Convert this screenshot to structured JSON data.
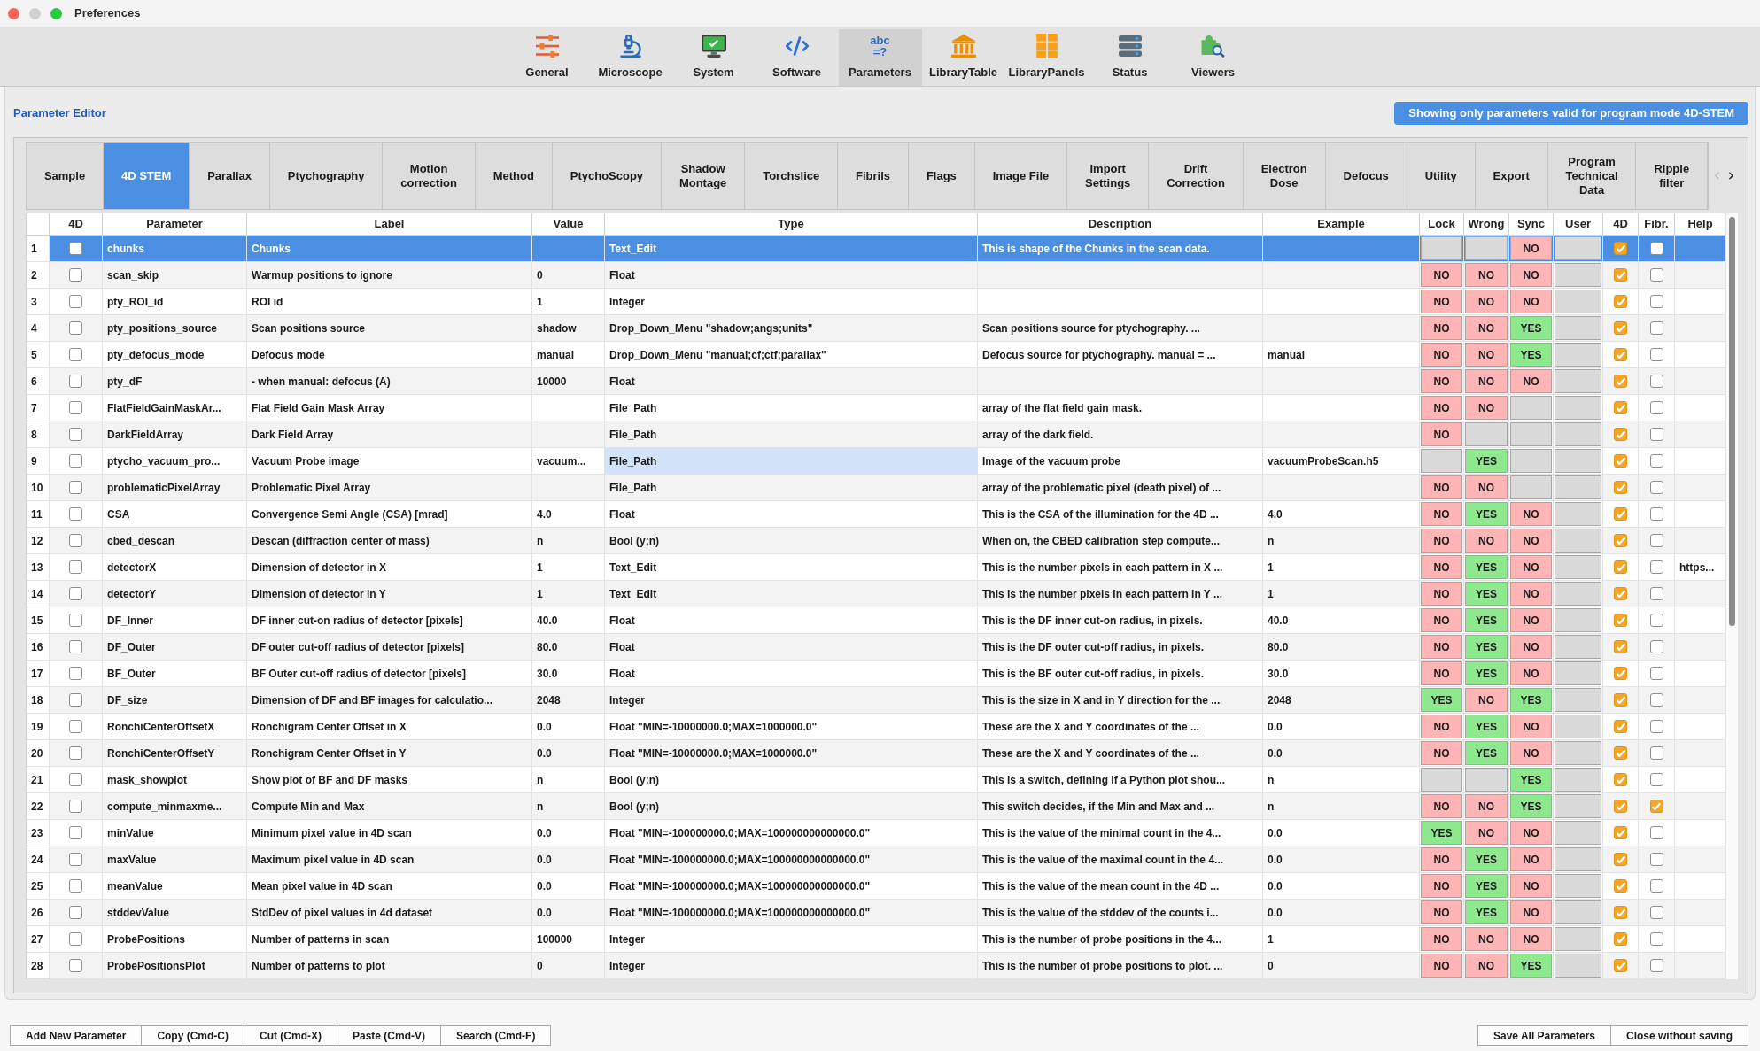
{
  "window": {
    "title": "Preferences",
    "controls": [
      {
        "kind": "close",
        "disabled": false
      },
      {
        "kind": "minimize",
        "disabled": true
      },
      {
        "kind": "zoom",
        "disabled": false
      }
    ]
  },
  "toolbar": {
    "items": [
      {
        "label": "General",
        "selected": false
      },
      {
        "label": "Microscope",
        "selected": false
      },
      {
        "label": "System",
        "selected": false
      },
      {
        "label": "Software",
        "selected": false
      },
      {
        "label": "Parameters",
        "selected": true,
        "glyph": [
          "abc",
          "=?"
        ]
      },
      {
        "label": "LibraryTable",
        "selected": false
      },
      {
        "label": "LibraryPanels",
        "selected": false
      },
      {
        "label": "Status",
        "selected": false
      },
      {
        "label": "Viewers",
        "selected": false
      }
    ]
  },
  "editor": {
    "title": "Parameter Editor",
    "filter_button": "Showing only parameters valid for program mode 4D-STEM",
    "tabs": [
      {
        "label": "Sample",
        "selected": false
      },
      {
        "label": "4D STEM",
        "selected": true
      },
      {
        "label": "Parallax",
        "selected": false
      },
      {
        "label": "Ptychography",
        "selected": false
      },
      {
        "label": "Motion\ncorrection",
        "selected": false
      },
      {
        "label": "Method",
        "selected": false
      },
      {
        "label": "PtychoScopy",
        "selected": false
      },
      {
        "label": "Shadow\nMontage",
        "selected": false
      },
      {
        "label": "Torchslice",
        "selected": false
      },
      {
        "label": "Fibrils",
        "selected": false
      },
      {
        "label": "Flags",
        "selected": false
      },
      {
        "label": "Image File",
        "selected": false
      },
      {
        "label": "Import\nSettings",
        "selected": false
      },
      {
        "label": "Drift\nCorrection",
        "selected": false
      },
      {
        "label": "Electron\nDose",
        "selected": false
      },
      {
        "label": "Defocus",
        "selected": false
      },
      {
        "label": "Utility",
        "selected": false
      },
      {
        "label": "Export",
        "selected": false
      },
      {
        "label": "Program\nTechnical\nData",
        "selected": false
      },
      {
        "label": "Ripple\nfilter",
        "selected": false
      }
    ],
    "tab_scroll": {
      "back_disabled": true,
      "forward_disabled": false
    },
    "table": {
      "columns": [
        "4D",
        "Parameter",
        "Label",
        "Value",
        "Type",
        "Description",
        "Example",
        "Lock",
        "Wrong",
        "Sync",
        "User",
        "4D",
        "Fibr.",
        "Help"
      ],
      "rows": [
        {
          "number": "1",
          "selected": true,
          "checkbox_4d": false,
          "parameter": "chunks",
          "label": "Chunks",
          "type": "Text_Edit",
          "type_focused": false,
          "description": "This is shape of the Chunks in the scan data.",
          "lock": {
            "kind": "unset"
          },
          "wrong": {
            "kind": "unset"
          },
          "sync": {
            "kind": "no",
            "text": "NO"
          },
          "user": {
            "kind": "unset"
          },
          "flag_4d": true,
          "flag_fibr": false
        },
        {
          "number": "2",
          "selected": false,
          "checkbox_4d": false,
          "parameter": "scan_skip",
          "label": "Warmup positions to ignore",
          "value": "0",
          "type": "Float",
          "type_focused": false,
          "lock": {
            "kind": "no",
            "text": "NO"
          },
          "wrong": {
            "kind": "no",
            "text": "NO"
          },
          "sync": {
            "kind": "no",
            "text": "NO"
          },
          "user": {
            "kind": "unset"
          },
          "flag_4d": true,
          "flag_fibr": false
        },
        {
          "number": "3",
          "selected": false,
          "checkbox_4d": false,
          "parameter": "pty_ROI_id",
          "label": "ROI id",
          "value": "1",
          "type": "Integer",
          "type_focused": false,
          "lock": {
            "kind": "no",
            "text": "NO"
          },
          "wrong": {
            "kind": "no",
            "text": "NO"
          },
          "sync": {
            "kind": "no",
            "text": "NO"
          },
          "user": {
            "kind": "unset"
          },
          "flag_4d": true,
          "flag_fibr": false
        },
        {
          "number": "4",
          "selected": false,
          "checkbox_4d": false,
          "parameter": "pty_positions_source",
          "label": "Scan positions source",
          "value": "shadow",
          "type": "Drop_Down_Menu \"shadow;angs;units\"",
          "type_focused": false,
          "description": "Scan positions source for ptychography. ...",
          "lock": {
            "kind": "no",
            "text": "NO"
          },
          "wrong": {
            "kind": "no",
            "text": "NO"
          },
          "sync": {
            "kind": "yes",
            "text": "YES"
          },
          "user": {
            "kind": "unset"
          },
          "flag_4d": true,
          "flag_fibr": false
        },
        {
          "number": "5",
          "selected": false,
          "checkbox_4d": false,
          "parameter": "pty_defocus_mode",
          "label": "Defocus mode",
          "value": "manual",
          "type": "Drop_Down_Menu \"manual;cf;ctf;parallax\"",
          "type_focused": false,
          "description": "Defocus source for ptychography. manual = ...",
          "example": "manual",
          "lock": {
            "kind": "no",
            "text": "NO"
          },
          "wrong": {
            "kind": "no",
            "text": "NO"
          },
          "sync": {
            "kind": "yes",
            "text": "YES"
          },
          "user": {
            "kind": "unset"
          },
          "flag_4d": true,
          "flag_fibr": false
        },
        {
          "number": "6",
          "selected": false,
          "checkbox_4d": false,
          "parameter": "pty_dF",
          "label": "- when manual: defocus (A)",
          "value": "10000",
          "type": "Float",
          "type_focused": false,
          "lock": {
            "kind": "no",
            "text": "NO"
          },
          "wrong": {
            "kind": "no",
            "text": "NO"
          },
          "sync": {
            "kind": "no",
            "text": "NO"
          },
          "user": {
            "kind": "unset"
          },
          "flag_4d": true,
          "flag_fibr": false
        },
        {
          "number": "7",
          "selected": false,
          "checkbox_4d": false,
          "parameter": "FlatFieldGainMaskAr...",
          "label": "Flat Field Gain Mask Array",
          "type": "File_Path",
          "type_focused": false,
          "description": "array of the flat field gain mask.",
          "lock": {
            "kind": "no",
            "text": "NO"
          },
          "wrong": {
            "kind": "no",
            "text": "NO"
          },
          "sync": {
            "kind": "unset"
          },
          "user": {
            "kind": "unset"
          },
          "flag_4d": true,
          "flag_fibr": false
        },
        {
          "number": "8",
          "selected": false,
          "checkbox_4d": false,
          "parameter": "DarkFieldArray",
          "label": "Dark Field Array",
          "type": "File_Path",
          "type_focused": false,
          "description": "array of the dark field.",
          "lock": {
            "kind": "no",
            "text": "NO"
          },
          "wrong": {
            "kind": "unset"
          },
          "sync": {
            "kind": "unset"
          },
          "user": {
            "kind": "unset"
          },
          "flag_4d": true,
          "flag_fibr": false
        },
        {
          "number": "9",
          "selected": false,
          "checkbox_4d": false,
          "parameter": "ptycho_vacuum_pro...",
          "label": "Vacuum Probe image",
          "value": "vacuum...",
          "type": "File_Path",
          "type_focused": true,
          "description": "Image of the vacuum probe",
          "example": "vacuumProbeScan.h5",
          "lock": {
            "kind": "unset"
          },
          "wrong": {
            "kind": "yes",
            "text": "YES"
          },
          "sync": {
            "kind": "unset"
          },
          "user": {
            "kind": "unset"
          },
          "flag_4d": true,
          "flag_fibr": false
        },
        {
          "number": "10",
          "selected": false,
          "checkbox_4d": false,
          "parameter": "problematicPixelArray",
          "label": "Problematic Pixel Array",
          "type": "File_Path",
          "type_focused": false,
          "description": "array of the problematic pixel (death pixel) of ...",
          "lock": {
            "kind": "no",
            "text": "NO"
          },
          "wrong": {
            "kind": "no",
            "text": "NO"
          },
          "sync": {
            "kind": "unset"
          },
          "user": {
            "kind": "unset"
          },
          "flag_4d": true,
          "flag_fibr": false
        },
        {
          "number": "11",
          "selected": false,
          "checkbox_4d": false,
          "parameter": "CSA",
          "label": "Convergence Semi Angle (CSA) [mrad]",
          "value": "4.0",
          "type": "Float",
          "type_focused": false,
          "description": "This is the CSA of the illumination for the 4D ...",
          "example": "4.0",
          "lock": {
            "kind": "no",
            "text": "NO"
          },
          "wrong": {
            "kind": "yes",
            "text": "YES"
          },
          "sync": {
            "kind": "no",
            "text": "NO"
          },
          "user": {
            "kind": "unset"
          },
          "flag_4d": true,
          "flag_fibr": false
        },
        {
          "number": "12",
          "selected": false,
          "checkbox_4d": false,
          "parameter": "cbed_descan",
          "label": "Descan (diffraction center of mass)",
          "value": "n",
          "type": "Bool (y;n)",
          "type_focused": false,
          "description": "When on, the CBED calibration step compute...",
          "example": "n",
          "lock": {
            "kind": "no",
            "text": "NO"
          },
          "wrong": {
            "kind": "no",
            "text": "NO"
          },
          "sync": {
            "kind": "no",
            "text": "NO"
          },
          "user": {
            "kind": "unset"
          },
          "flag_4d": true,
          "flag_fibr": false
        },
        {
          "number": "13",
          "selected": false,
          "checkbox_4d": false,
          "parameter": "detectorX",
          "label": "Dimension of detector in X",
          "value": "1",
          "type": "Text_Edit",
          "type_focused": false,
          "description": "This is the number pixels in each pattern in X ...",
          "example": "1",
          "lock": {
            "kind": "no",
            "text": "NO"
          },
          "wrong": {
            "kind": "yes",
            "text": "YES"
          },
          "sync": {
            "kind": "no",
            "text": "NO"
          },
          "user": {
            "kind": "unset"
          },
          "flag_4d": true,
          "flag_fibr": false,
          "help": "https..."
        },
        {
          "number": "14",
          "selected": false,
          "checkbox_4d": false,
          "parameter": "detectorY",
          "label": "Dimension of detector in Y",
          "value": "1",
          "type": "Text_Edit",
          "type_focused": false,
          "description": "This is the number pixels in each pattern in Y ...",
          "example": "1",
          "lock": {
            "kind": "no",
            "text": "NO"
          },
          "wrong": {
            "kind": "yes",
            "text": "YES"
          },
          "sync": {
            "kind": "no",
            "text": "NO"
          },
          "user": {
            "kind": "unset"
          },
          "flag_4d": true,
          "flag_fibr": false
        },
        {
          "number": "15",
          "selected": false,
          "checkbox_4d": false,
          "parameter": "DF_Inner",
          "label": "DF inner cut-on radius of detector [pixels]",
          "value": "40.0",
          "type": "Float",
          "type_focused": false,
          "description": "This is the DF inner cut-on radius, in pixels.",
          "example": "40.0",
          "lock": {
            "kind": "no",
            "text": "NO"
          },
          "wrong": {
            "kind": "yes",
            "text": "YES"
          },
          "sync": {
            "kind": "no",
            "text": "NO"
          },
          "user": {
            "kind": "unset"
          },
          "flag_4d": true,
          "flag_fibr": false
        },
        {
          "number": "16",
          "selected": false,
          "checkbox_4d": false,
          "parameter": "DF_Outer",
          "label": "DF outer cut-off radius of detector [pixels]",
          "value": "80.0",
          "type": "Float",
          "type_focused": false,
          "description": "This is the DF outer cut-off radius, in pixels.",
          "example": "80.0",
          "lock": {
            "kind": "no",
            "text": "NO"
          },
          "wrong": {
            "kind": "yes",
            "text": "YES"
          },
          "sync": {
            "kind": "no",
            "text": "NO"
          },
          "user": {
            "kind": "unset"
          },
          "flag_4d": true,
          "flag_fibr": false
        },
        {
          "number": "17",
          "selected": false,
          "checkbox_4d": false,
          "parameter": "BF_Outer",
          "label": "BF Outer cut-off radius of detector [pixels]",
          "value": "30.0",
          "type": "Float",
          "type_focused": false,
          "description": "This is the BF outer cut-off radius, in pixels.",
          "example": "30.0",
          "lock": {
            "kind": "no",
            "text": "NO"
          },
          "wrong": {
            "kind": "yes",
            "text": "YES"
          },
          "sync": {
            "kind": "no",
            "text": "NO"
          },
          "user": {
            "kind": "unset"
          },
          "flag_4d": true,
          "flag_fibr": false
        },
        {
          "number": "18",
          "selected": false,
          "checkbox_4d": false,
          "parameter": "DF_size",
          "label": "Dimension of DF and BF images for calculatio...",
          "value": "2048",
          "type": "Integer",
          "type_focused": false,
          "description": "This is the size in X and in Y direction for the ...",
          "example": "2048",
          "lock": {
            "kind": "yes",
            "text": "YES"
          },
          "wrong": {
            "kind": "no",
            "text": "NO"
          },
          "sync": {
            "kind": "yes",
            "text": "YES"
          },
          "user": {
            "kind": "unset"
          },
          "flag_4d": true,
          "flag_fibr": false
        },
        {
          "number": "19",
          "selected": false,
          "checkbox_4d": false,
          "parameter": "RonchiCenterOffsetX",
          "label": "Ronchigram Center Offset in X",
          "value": "0.0",
          "type": "Float \"MIN=-10000000.0;MAX=1000000.0\"",
          "type_focused": false,
          "description": "These are the X and Y coordinates of the ...",
          "example": "0.0",
          "lock": {
            "kind": "no",
            "text": "NO"
          },
          "wrong": {
            "kind": "yes",
            "text": "YES"
          },
          "sync": {
            "kind": "no",
            "text": "NO"
          },
          "user": {
            "kind": "unset"
          },
          "flag_4d": true,
          "flag_fibr": false
        },
        {
          "number": "20",
          "selected": false,
          "checkbox_4d": false,
          "parameter": "RonchiCenterOffsetY",
          "label": "Ronchigram Center Offset in Y",
          "value": "0.0",
          "type": "Float \"MIN=-10000000.0;MAX=1000000.0\"",
          "type_focused": false,
          "description": "These are the X and Y coordinates of the ...",
          "example": "0.0",
          "lock": {
            "kind": "no",
            "text": "NO"
          },
          "wrong": {
            "kind": "yes",
            "text": "YES"
          },
          "sync": {
            "kind": "no",
            "text": "NO"
          },
          "user": {
            "kind": "unset"
          },
          "flag_4d": true,
          "flag_fibr": false
        },
        {
          "number": "21",
          "selected": false,
          "checkbox_4d": false,
          "parameter": "mask_showplot",
          "label": "Show plot of BF and DF masks",
          "value": "n",
          "type": "Bool (y;n)",
          "type_focused": false,
          "description": "This is a switch, defining if a Python plot shou...",
          "example": "n",
          "lock": {
            "kind": "unset"
          },
          "wrong": {
            "kind": "unset"
          },
          "sync": {
            "kind": "yes",
            "text": "YES"
          },
          "user": {
            "kind": "unset"
          },
          "flag_4d": true,
          "flag_fibr": false
        },
        {
          "number": "22",
          "selected": false,
          "checkbox_4d": false,
          "parameter": "compute_minmaxme...",
          "label": "Compute Min and Max",
          "value": "n",
          "type": "Bool (y;n)",
          "type_focused": false,
          "description": "This switch decides, if the Min and Max and ...",
          "example": "n",
          "lock": {
            "kind": "no",
            "text": "NO"
          },
          "wrong": {
            "kind": "no",
            "text": "NO"
          },
          "sync": {
            "kind": "yes",
            "text": "YES"
          },
          "user": {
            "kind": "unset"
          },
          "flag_4d": true,
          "flag_fibr": true
        },
        {
          "number": "23",
          "selected": false,
          "checkbox_4d": false,
          "parameter": "minValue",
          "label": "Minimum pixel value in 4D scan",
          "value": "0.0",
          "type": "Float \"MIN=-100000000.0;MAX=100000000000000.0\"",
          "type_focused": false,
          "description": "This is the value of the minimal count in the 4...",
          "example": "0.0",
          "lock": {
            "kind": "yes",
            "text": "YES"
          },
          "wrong": {
            "kind": "no",
            "text": "NO"
          },
          "sync": {
            "kind": "no",
            "text": "NO"
          },
          "user": {
            "kind": "unset"
          },
          "flag_4d": true,
          "flag_fibr": false
        },
        {
          "number": "24",
          "selected": false,
          "checkbox_4d": false,
          "parameter": "maxValue",
          "label": "Maximum pixel value in 4D scan",
          "value": "0.0",
          "type": "Float \"MIN=-100000000.0;MAX=100000000000000.0\"",
          "type_focused": false,
          "description": "This is the value of the maximal count in the 4...",
          "example": "0.0",
          "lock": {
            "kind": "no",
            "text": "NO"
          },
          "wrong": {
            "kind": "yes",
            "text": "YES"
          },
          "sync": {
            "kind": "no",
            "text": "NO"
          },
          "user": {
            "kind": "unset"
          },
          "flag_4d": true,
          "flag_fibr": false
        },
        {
          "number": "25",
          "selected": false,
          "checkbox_4d": false,
          "parameter": "meanValue",
          "label": "Mean pixel value in 4D scan",
          "value": "0.0",
          "type": "Float \"MIN=-100000000.0;MAX=100000000000000.0\"",
          "type_focused": false,
          "description": "This is the value of the mean count in the 4D ...",
          "example": "0.0",
          "lock": {
            "kind": "no",
            "text": "NO"
          },
          "wrong": {
            "kind": "yes",
            "text": "YES"
          },
          "sync": {
            "kind": "no",
            "text": "NO"
          },
          "user": {
            "kind": "unset"
          },
          "flag_4d": true,
          "flag_fibr": false
        },
        {
          "number": "26",
          "selected": false,
          "checkbox_4d": false,
          "parameter": "stddevValue",
          "label": "StdDev of pixel values in 4d dataset",
          "value": "0.0",
          "type": "Float \"MIN=-100000000.0;MAX=100000000000000.0\"",
          "type_focused": false,
          "description": "This is the value of the stddev of the counts i...",
          "example": "0.0",
          "lock": {
            "kind": "no",
            "text": "NO"
          },
          "wrong": {
            "kind": "yes",
            "text": "YES"
          },
          "sync": {
            "kind": "no",
            "text": "NO"
          },
          "user": {
            "kind": "unset"
          },
          "flag_4d": true,
          "flag_fibr": false
        },
        {
          "number": "27",
          "selected": false,
          "checkbox_4d": false,
          "parameter": "ProbePositions",
          "label": "Number of patterns in scan",
          "value": "100000",
          "type": "Integer",
          "type_focused": false,
          "description": "This is the number of probe positions in the 4...",
          "example": "1",
          "lock": {
            "kind": "no",
            "text": "NO"
          },
          "wrong": {
            "kind": "no",
            "text": "NO"
          },
          "sync": {
            "kind": "no",
            "text": "NO"
          },
          "user": {
            "kind": "unset"
          },
          "flag_4d": true,
          "flag_fibr": false
        },
        {
          "number": "28",
          "selected": false,
          "checkbox_4d": false,
          "parameter": "ProbePositionsPlot",
          "label": "Number of patterns to plot",
          "value": "0",
          "type": "Integer",
          "type_focused": false,
          "description": "This is the number of probe positions to plot. ...",
          "example": "0",
          "lock": {
            "kind": "no",
            "text": "NO"
          },
          "wrong": {
            "kind": "no",
            "text": "NO"
          },
          "sync": {
            "kind": "yes",
            "text": "YES"
          },
          "user": {
            "kind": "unset"
          },
          "flag_4d": true,
          "flag_fibr": false
        }
      ]
    }
  },
  "buttons_left": [
    "Add New Parameter",
    "Copy (Cmd-C)",
    "Cut (Cmd-X)",
    "Paste (Cmd-V)",
    "Search (Cmd-F)"
  ],
  "buttons_right": [
    "Save All Parameters",
    "Close without saving"
  ]
}
